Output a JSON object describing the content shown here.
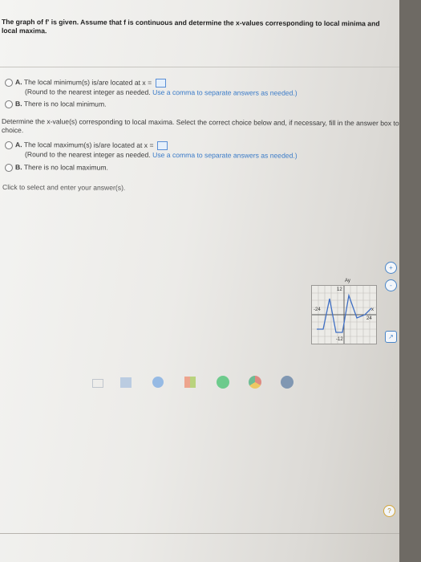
{
  "question": {
    "line1": "The graph of f' is given. Assume that f is continuous and determine the x-values corresponding to local minima and",
    "line2": "local maxima."
  },
  "part1": {
    "a_letter": "A.",
    "a_text": "The local minimum(s) is/are located at x =",
    "a_note_pre": "(Round to the nearest integer as needed.",
    "a_note_hl": "Use a comma to separate answers as needed.)",
    "b_letter": "B.",
    "b_text": "There is no local minimum."
  },
  "prompt2": {
    "line1": "Determine the x-value(s) corresponding to local maxima. Select the correct choice below and, if necessary, fill in the answer box to complete your",
    "line2": "choice."
  },
  "part2": {
    "a_letter": "A.",
    "a_text": "The local maximum(s) is/are located at x =",
    "a_note_pre": "(Round to the nearest integer as needed.",
    "a_note_hl": "Use a comma to separate answers as needed.)",
    "b_letter": "B.",
    "b_text": "There is no local maximum."
  },
  "footer": {
    "hint": "Click to select and enter your answer(s)."
  },
  "graph": {
    "y_axis_label": "Ay",
    "y_top": "12",
    "y_bottom": "-12",
    "x_left": "-24",
    "x_right": "24",
    "x_axis_label": "x"
  },
  "side_icons": {
    "zoom_in": "+",
    "zoom_out": "-",
    "popout": "↗",
    "help": "?"
  },
  "colors": {
    "accent": "#3a7bc8",
    "answer_box": "#e6f0fb"
  }
}
